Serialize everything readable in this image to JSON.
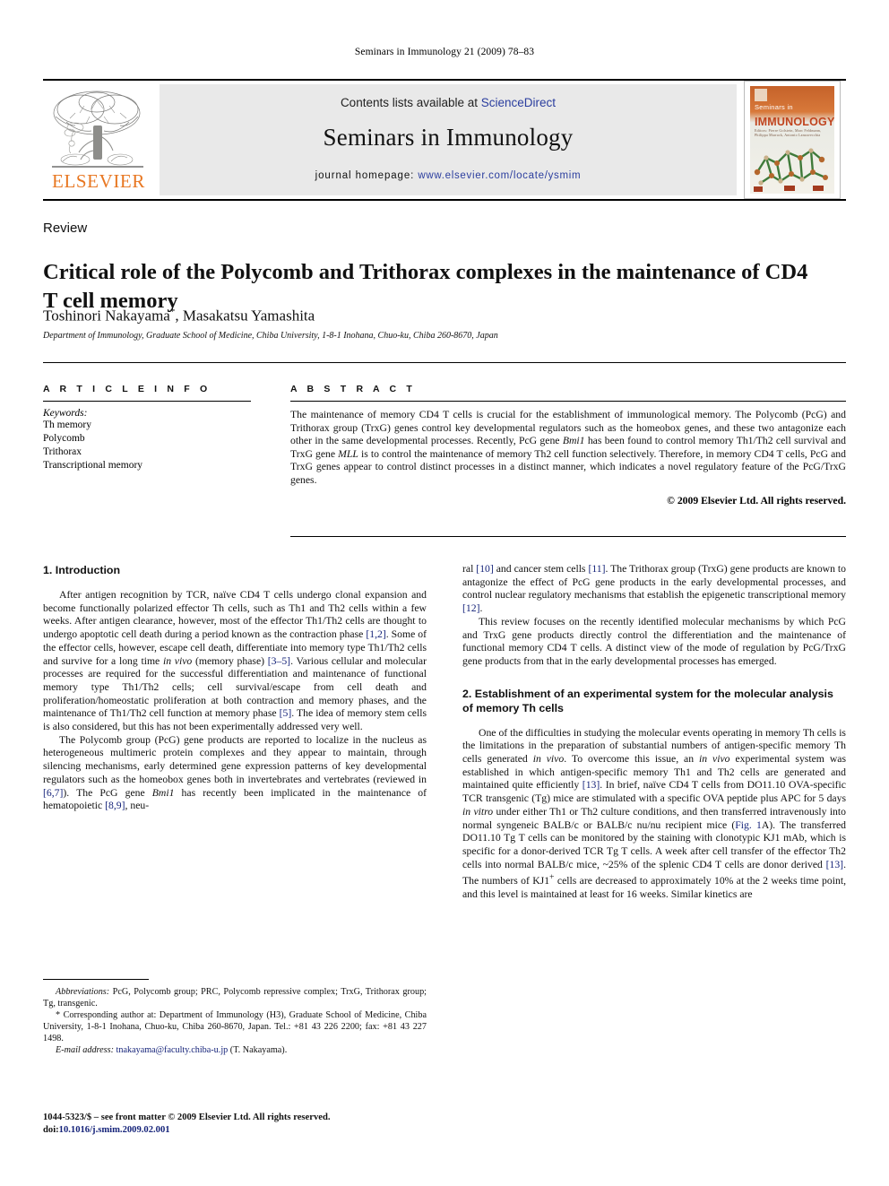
{
  "running_head": "Seminars in Immunology 21 (2009) 78–83",
  "masthead": {
    "publisher_name": "ELSEVIER",
    "contents_prefix": "Contents lists available at ",
    "contents_link": "ScienceDirect",
    "journal_title": "Seminars in Immunology",
    "homepage_label": "journal homepage:",
    "homepage_url": "www.elsevier.com/locate/ysmim",
    "cover": {
      "line1": "Seminars in",
      "line2": "IMMUNOLOGY",
      "line3": "Editors: Pierre Golstein, Marc Feldmann, Philippa Marrack, Antonio Lanzavecchia",
      "accent_color": "#c5622a"
    },
    "accent_color": "#E87722",
    "link_color": "#2a3d9e"
  },
  "article": {
    "doctype": "Review",
    "title": "Critical role of the Polycomb and Trithorax complexes in the maintenance of CD4 T cell memory",
    "authors": "Toshinori Nakayama",
    "authors_rest": ", Masakatsu Yamashita",
    "corresponding_marker": "*",
    "affiliation": "Department of Immunology, Graduate School of Medicine, Chiba University, 1-8-1 Inohana, Chuo-ku, Chiba 260-8670, Japan"
  },
  "article_info": {
    "heading": "A R T I C L E   I N F O",
    "keywords_label": "Keywords:",
    "keywords": [
      "Th memory",
      "Polycomb",
      "Trithorax",
      "Transcriptional memory"
    ]
  },
  "abstract": {
    "heading": "A B S T R A C T",
    "text": "The maintenance of memory CD4 T cells is crucial for the establishment of immunological memory. The Polycomb (PcG) and Trithorax group (TrxG) genes control key developmental regulators such as the homeobox genes, and these two antagonize each other in the same developmental processes. Recently, PcG gene Bmi1 has been found to control memory Th1/Th2 cell survival and TrxG gene MLL is to control the maintenance of memory Th2 cell function selectively. Therefore, in memory CD4 T cells, PcG and TrxG genes appear to control distinct processes in a distinct manner, which indicates a novel regulatory feature of the PcG/TrxG genes.",
    "copyright": "© 2009 Elsevier Ltd. All rights reserved."
  },
  "sections": {
    "introduction_heading": "1.  Introduction",
    "intro_p1": "After antigen recognition by TCR, naïve CD4 T cells undergo clonal expansion and become functionally polarized effector Th cells, such as Th1 and Th2 cells within a few weeks. After antigen clearance, however, most of the effector Th1/Th2 cells are thought to undergo apoptotic cell death during a period known as the contraction phase [1,2]. Some of the effector cells, however, escape cell death, differentiate into memory type Th1/Th2 cells and survive for a long time in vivo (memory phase) [3–5]. Various cellular and molecular processes are required for the successful differentiation and maintenance of functional memory type Th1/Th2 cells; cell survival/escape from cell death and proliferation/homeostatic proliferation at both contraction and memory phases, and the maintenance of Th1/Th2 cell function at memory phase [5]. The idea of memory stem cells is also considered, but this has not been experimentally addressed very well.",
    "intro_p2": "The Polycomb group (PcG) gene products are reported to localize in the nucleus as heterogeneous multimeric protein complexes and they appear to maintain, through silencing mechanisms, early determined gene expression patterns of key developmental regulators such as the homeobox genes both in invertebrates and vertebrates (reviewed in [6,7]). The PcG gene Bmi1 has recently been implicated in the maintenance of hematopoietic [8,9], neural [10] and cancer stem cells [11]. The Trithorax group (TrxG) gene products are known to antagonize the effect of PcG gene products in the early developmental processes, and control nuclear regulatory mechanisms that establish the epigenetic transcriptional memory [12].",
    "intro_p3": "This review focuses on the recently identified molecular mechanisms by which PcG and TrxG gene products directly control the differentiation and the maintenance of functional memory CD4 T cells. A distinct view of the mode of regulation by PcG/TrxG gene products from that in the early developmental processes has emerged.",
    "section2_heading": "2.  Establishment of an experimental system for the molecular analysis of memory Th cells",
    "sec2_p1": "One of the difficulties in studying the molecular events operating in memory Th cells is the limitations in the preparation of substantial numbers of antigen-specific memory Th cells generated in vivo. To overcome this issue, an in vivo experimental system was established in which antigen-specific memory Th1 and Th2 cells are generated and maintained quite efficiently [13]. In brief, naïve CD4 T cells from DO11.10 OVA-specific TCR transgenic (Tg) mice are stimulated with a specific OVA peptide plus APC for 5 days in vitro under either Th1 or Th2 culture conditions, and then transferred intravenously into normal syngeneic BALB/c or BALB/c nu/nu recipient mice (Fig. 1A). The transferred DO11.10 Tg T cells can be monitored by the staining with clonotypic KJ1 mAb, which is specific for a donor-derived TCR Tg T cells. A week after cell transfer of the effector Th2 cells into normal BALB/c mice, ~25% of the splenic CD4 T cells are donor derived [13]. The numbers of KJ1+ cells are decreased to approximately 10% at the 2 weeks time point, and this level is maintained at least for 16 weeks. Similar kinetics are"
  },
  "footnotes": {
    "abbreviations_label": "Abbreviations:",
    "abbreviations": " PcG, Polycomb group; PRC, Polycomb repressive complex; TrxG, Trithorax group; Tg, transgenic.",
    "corresponding_marker": "*",
    "corresponding": " Corresponding author at: Department of Immunology (H3), Graduate School of Medicine, Chiba University, 1-8-1 Inohana, Chuo-ku, Chiba 260-8670, Japan. Tel.: +81 43 226 2200; fax: +81 43 227 1498.",
    "email_label": "E-mail address:",
    "email": "tnakayama@faculty.chiba-u.jp",
    "email_suffix": " (T. Nakayama)."
  },
  "imprint": {
    "line1": "1044-5323/$ – see front matter © 2009 Elsevier Ltd. All rights reserved.",
    "doi_prefix": "doi:",
    "doi": "10.1016/j.smim.2009.02.001"
  }
}
